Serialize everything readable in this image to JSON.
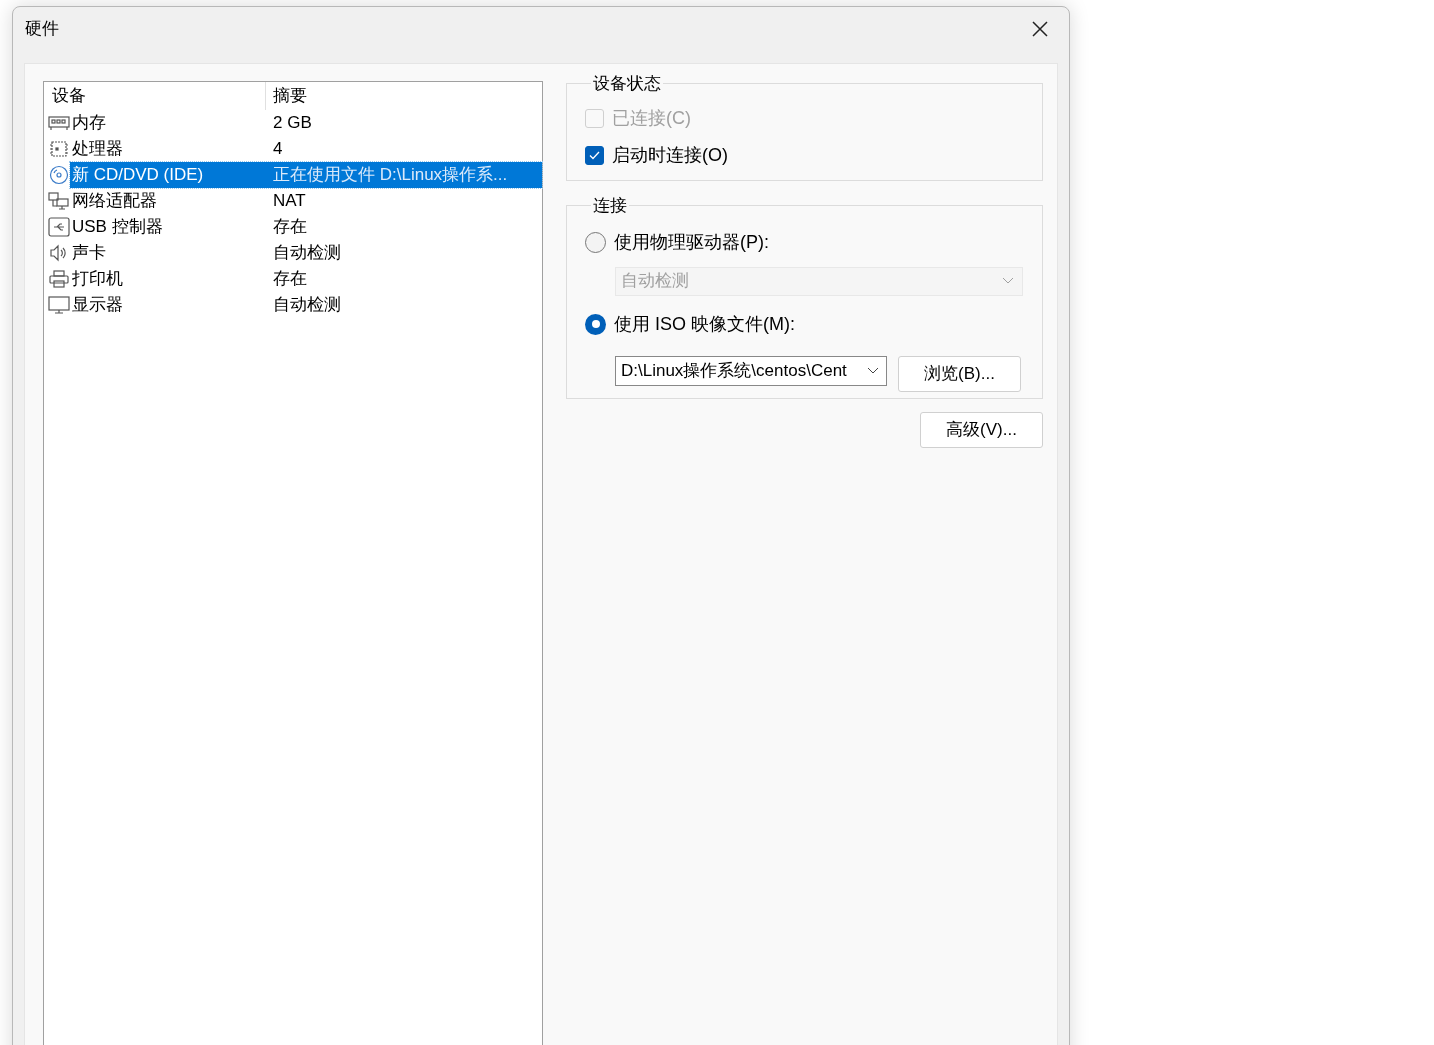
{
  "window": {
    "title": "硬件"
  },
  "devices": {
    "columns": [
      "设备",
      "摘要"
    ],
    "rows": [
      {
        "kind": "memory",
        "device": "内存",
        "summary": "2 GB",
        "selected": false
      },
      {
        "kind": "cpu",
        "device": "处理器",
        "summary": "4",
        "selected": false
      },
      {
        "kind": "disc",
        "device": "新 CD/DVD (IDE)",
        "summary": "正在使用文件 D:\\Linux操作系...",
        "selected": true
      },
      {
        "kind": "network",
        "device": "网络适配器",
        "summary": "NAT",
        "selected": false
      },
      {
        "kind": "usb",
        "device": "USB 控制器",
        "summary": "存在",
        "selected": false
      },
      {
        "kind": "sound",
        "device": "声卡",
        "summary": "自动检测",
        "selected": false
      },
      {
        "kind": "printer",
        "device": "打印机",
        "summary": "存在",
        "selected": false
      },
      {
        "kind": "display",
        "device": "显示器",
        "summary": "自动检测",
        "selected": false
      }
    ]
  },
  "device_status": {
    "title": "设备状态",
    "options": [
      {
        "label": "已连接(C)",
        "checked": false,
        "disabled": true
      },
      {
        "label": "启动时连接(O)",
        "checked": true,
        "disabled": false
      }
    ]
  },
  "connection": {
    "title": "连接",
    "physical": {
      "label": "使用物理驱动器(P):",
      "selected": false,
      "dropdown": {
        "value": "自动检测",
        "disabled": true
      }
    },
    "iso": {
      "label": "使用 ISO 映像文件(M):",
      "selected": true,
      "path": "D:\\Linux操作系统\\centos\\Cent",
      "browse": "浏览(B)..."
    }
  },
  "advanced": "高级(V)..."
}
